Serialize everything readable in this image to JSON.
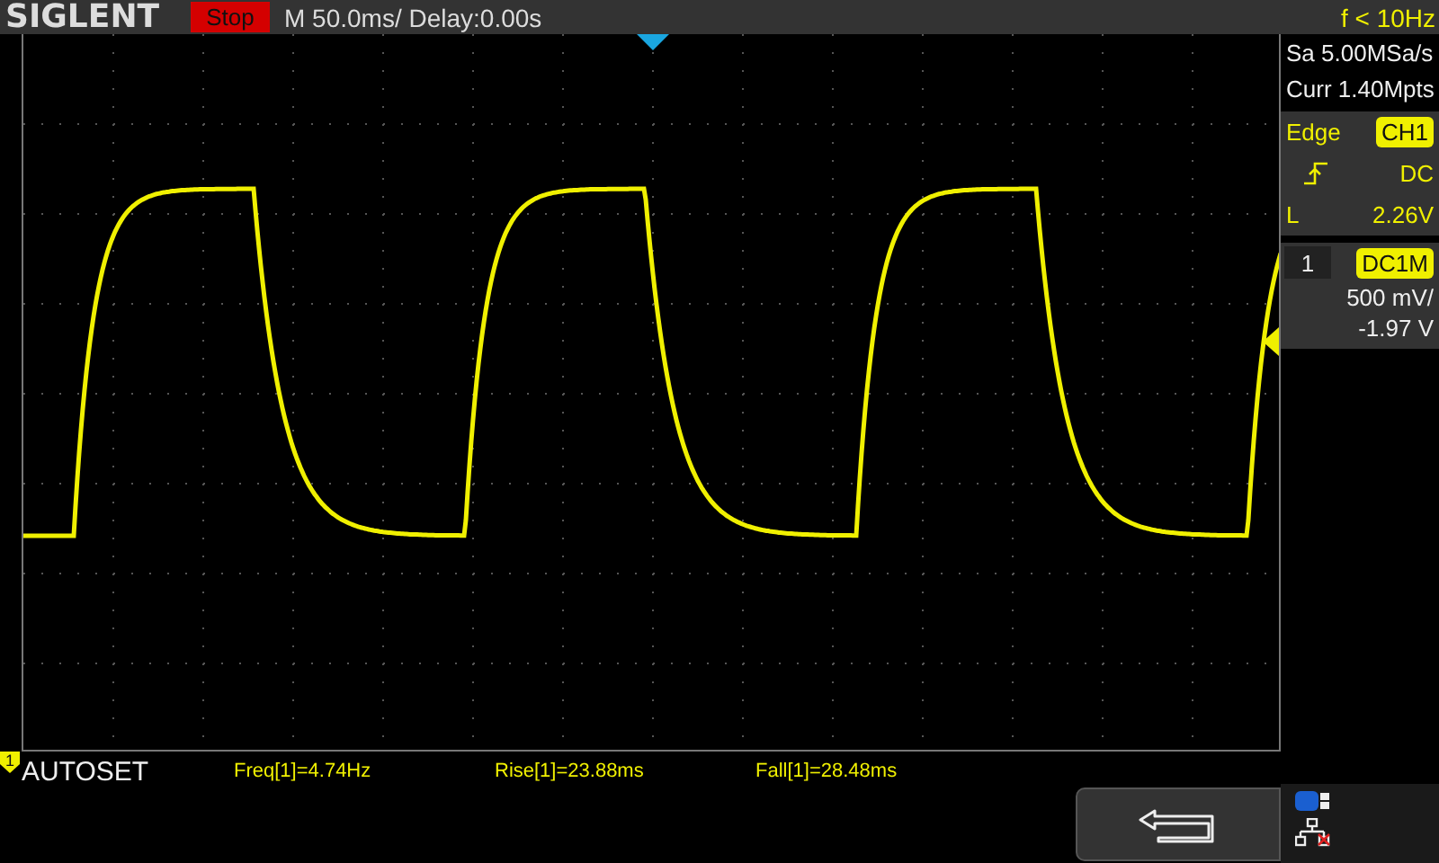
{
  "brand": "SIGLENT",
  "run_state": {
    "label": "Stop",
    "kind": "stop"
  },
  "timebase": "M 50.0ms/ Delay:0.00s",
  "trigger_frequency": "f < 10Hz",
  "acquisition": {
    "sample_rate": "Sa 5.00MSa/s",
    "memory": "Curr 1.40Mpts"
  },
  "trigger": {
    "type": "Edge",
    "source": "CH1",
    "coupling": "DC",
    "level_label": "L",
    "level_value": "2.26V"
  },
  "channel": {
    "number": "1",
    "coupling": "DC1M",
    "scale": "500 mV/",
    "offset": "-1.97 V",
    "marker": "1"
  },
  "footer_label": "AUTOSET",
  "measurements": [
    {
      "text": "Freq[1]=4.74Hz"
    },
    {
      "text": "Rise[1]=23.88ms"
    },
    {
      "text": "Fall[1]=28.48ms"
    }
  ]
}
